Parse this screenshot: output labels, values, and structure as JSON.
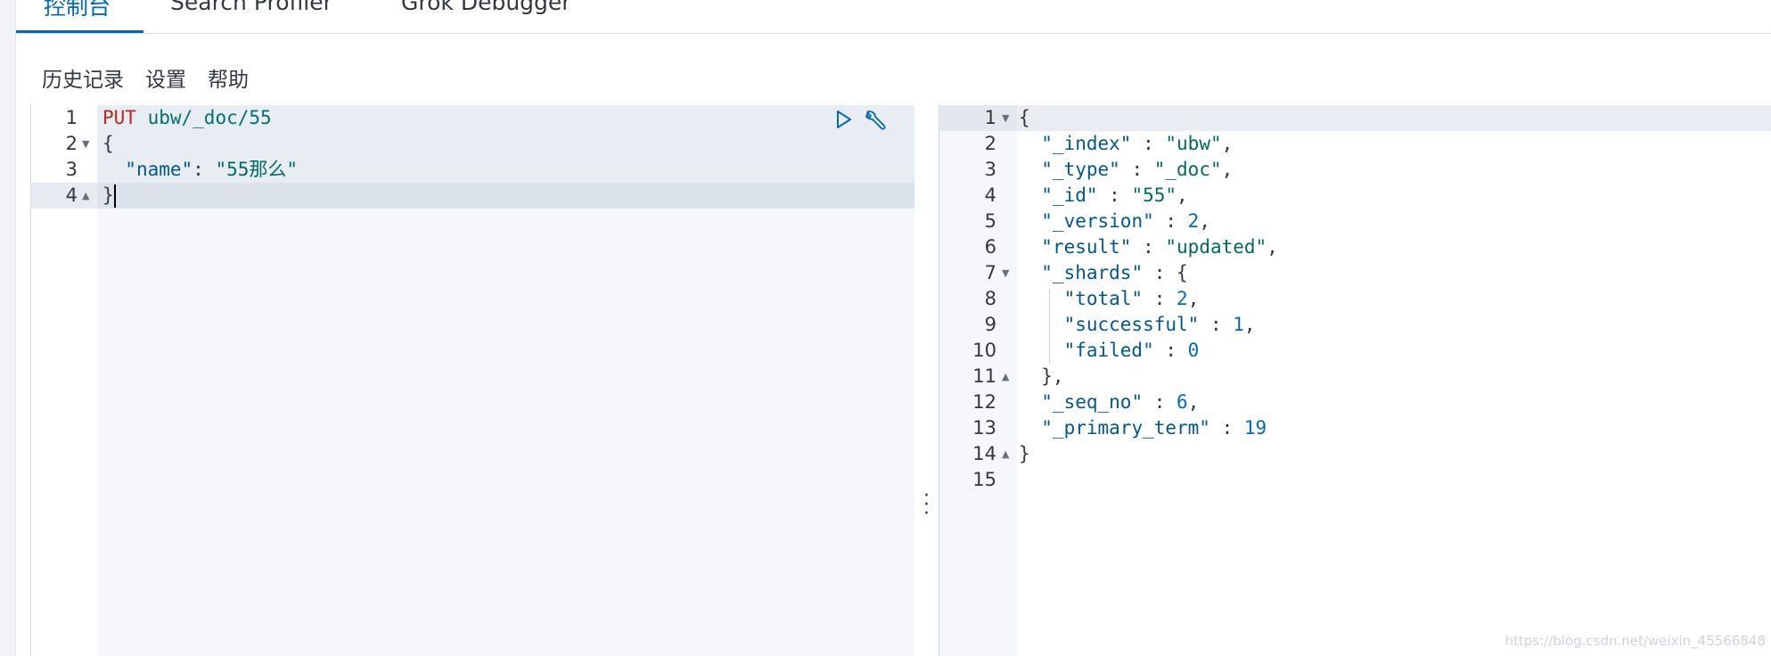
{
  "tabs": [
    {
      "label": "控制台",
      "active": true
    },
    {
      "label": "Search Profiler",
      "active": false
    },
    {
      "label": "Grok Debugger",
      "active": false
    }
  ],
  "menu": {
    "history": "历史记录",
    "settings": "设置",
    "help": "帮助"
  },
  "request": {
    "line_numbers": [
      "1",
      "2",
      "3",
      "4"
    ],
    "method": "PUT",
    "url": "ubw/_doc/55",
    "open_brace": "{",
    "field_key": "\"name\"",
    "field_value": "\"55那么\"",
    "close_brace": "}"
  },
  "response": {
    "line_numbers": [
      "1",
      "2",
      "3",
      "4",
      "5",
      "6",
      "7",
      "8",
      "9",
      "10",
      "11",
      "12",
      "13",
      "14",
      "15"
    ],
    "index_key": "\"_index\"",
    "index_val": "\"ubw\"",
    "type_key": "\"_type\"",
    "type_val": "\"_doc\"",
    "id_key": "\"_id\"",
    "id_val": "\"55\"",
    "version_key": "\"_version\"",
    "version_val": "2",
    "result_key": "\"result\"",
    "result_val": "\"updated\"",
    "shards_key": "\"_shards\"",
    "total_key": "\"total\"",
    "total_val": "2",
    "successful_key": "\"successful\"",
    "successful_val": "1",
    "failed_key": "\"failed\"",
    "failed_val": "0",
    "seq_no_key": "\"_seq_no\"",
    "seq_no_val": "6",
    "primary_term_key": "\"_primary_term\"",
    "primary_term_val": "19"
  },
  "icons": {
    "run": "play-icon",
    "tools": "wrench-icon",
    "resize": "vertical-dots-icon"
  },
  "colors": {
    "accent": "#006bb4",
    "method": "#bd271e",
    "string": "#006b5e",
    "key": "#00588f",
    "number": "#006bb4"
  },
  "watermark": "https://blog.csdn.net/weixin_45566848"
}
